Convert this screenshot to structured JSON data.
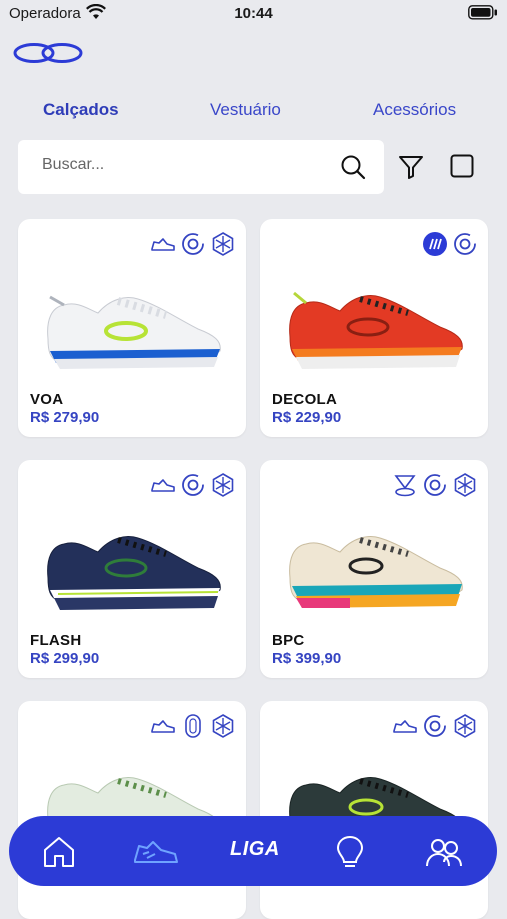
{
  "status": {
    "carrier": "Operadora",
    "time": "10:44"
  },
  "brand": {
    "accent": "#2c3bd6",
    "price_color": "#3544c2"
  },
  "tabs": [
    {
      "label": "Calçados",
      "active": true
    },
    {
      "label": "Vestuário",
      "active": false
    },
    {
      "label": "Acessórios",
      "active": false
    }
  ],
  "search": {
    "placeholder": "Buscar...",
    "value": ""
  },
  "products": [
    {
      "name": "VOA",
      "price": "R$ 279,90",
      "icons": [
        "shoe-icon",
        "rotate-icon",
        "snowflake-icon"
      ]
    },
    {
      "name": "DECOLA",
      "price": "R$ 229,90",
      "icons": [
        "speed-badge-icon",
        "rotate-icon"
      ]
    },
    {
      "name": "FLASH",
      "price": "R$ 299,90",
      "icons": [
        "shoe-icon",
        "rotate-icon",
        "snowflake-icon"
      ]
    },
    {
      "name": "BPC",
      "price": "R$ 399,90",
      "icons": [
        "pin-icon",
        "rotate-icon",
        "snowflake-icon"
      ]
    },
    {
      "name": "",
      "price": "",
      "icons": [
        "shoe-icon",
        "insole-icon",
        "snowflake-icon"
      ]
    },
    {
      "name": "",
      "price": "",
      "icons": [
        "shoe-icon",
        "rotate-icon",
        "snowflake-icon"
      ]
    }
  ],
  "nav": {
    "home": "home-icon",
    "shoe": "shoe-icon",
    "liga_label": "LIGA",
    "idea": "lightbulb-icon",
    "community": "people-icon"
  }
}
